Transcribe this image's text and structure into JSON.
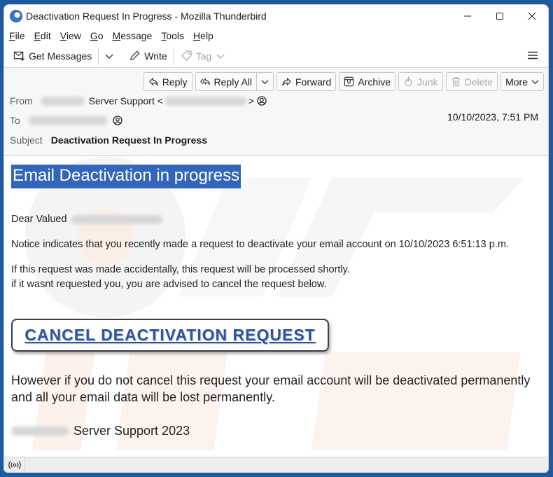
{
  "window": {
    "title": "Deactivation Request In Progress - Mozilla Thunderbird"
  },
  "menu": [
    {
      "label": "File",
      "accel": "F",
      "rest": "ile"
    },
    {
      "label": "Edit",
      "accel": "E",
      "rest": "dit"
    },
    {
      "label": "View",
      "accel": "V",
      "rest": "iew"
    },
    {
      "label": "Go",
      "accel": "G",
      "rest": "o"
    },
    {
      "label": "Message",
      "accel": "M",
      "rest": "essage"
    },
    {
      "label": "Tools",
      "accel": "T",
      "rest": "ools"
    },
    {
      "label": "Help",
      "accel": "H",
      "rest": "elp"
    }
  ],
  "toolbar": {
    "get_messages": "Get Messages",
    "write": "Write",
    "tag": "Tag"
  },
  "actions": {
    "reply": "Reply",
    "reply_all": "Reply All",
    "forward": "Forward",
    "archive": "Archive",
    "junk": "Junk",
    "delete": "Delete",
    "more": "More"
  },
  "header": {
    "from_label": "From",
    "from_name": "Server Support <",
    "from_suffix": ">",
    "to_label": "To",
    "subject_label": "Subject",
    "subject": "Deactivation Request In Progress",
    "date": "10/10/2023, 7:51 PM"
  },
  "email": {
    "headline": "Email Deactivation in progress",
    "greeting": "Dear Valued",
    "notice": "Notice indicates that you recently made a request to deactivate your email account on 10/10/2023 6:51:13 p.m.",
    "line1": "If this request was made accidentally, this request will be processed shortly.",
    "line2": "if it wasnt requested you, you are advised to cancel the request below.",
    "cta": "CANCEL DEACTIVATION REQUEST",
    "warning": "However if you do not cancel this request your email account will be deactivated permanently and all your email data will be lost permanently.",
    "signature": "Server Support 2023"
  },
  "colors": {
    "headline_bg": "#3366bb",
    "cta_text": "#2c55a8",
    "desktop": "#1f5a9e"
  }
}
